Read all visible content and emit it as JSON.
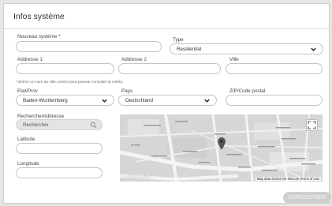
{
  "page": {
    "title": "Infos système"
  },
  "form": {
    "new_system": {
      "label": "Nouveau système *",
      "value": ""
    },
    "type": {
      "label": "Type",
      "value": "Residential"
    },
    "address1": {
      "label": "Addresse 1",
      "value": ""
    },
    "address2": {
      "label": "Addresse 2",
      "value": ""
    },
    "city": {
      "label": "Ville",
      "value": ""
    },
    "hint": "* Entrez un nom de ville correct pour pouvoir consulter la météo.",
    "state": {
      "label": "Etat/Prov",
      "value": "Baden-Wurttemberg"
    },
    "country": {
      "label": "Pays",
      "value": "Deutschland"
    },
    "zip": {
      "label": "ZIP/Code postal",
      "value": ""
    },
    "search": {
      "label": "RechercherAddresse",
      "placeholder": "Rechercher"
    },
    "latitude": {
      "label": "Latitude",
      "value": ""
    },
    "longitude": {
      "label": "Longitude",
      "value": ""
    }
  },
  "map": {
    "attribution": "Map data ©2019 SK telecom   Terms of Use",
    "logo": "Google",
    "fullscreen_icon": "fullscreen-icon",
    "marker_icon": "map-pin-icon"
  },
  "actions": {
    "save_label": "ENREGISTRER"
  },
  "colors": {
    "accent_disabled": "#cfcfcf",
    "field_border": "#c4c4c4",
    "marker": "#555555"
  }
}
